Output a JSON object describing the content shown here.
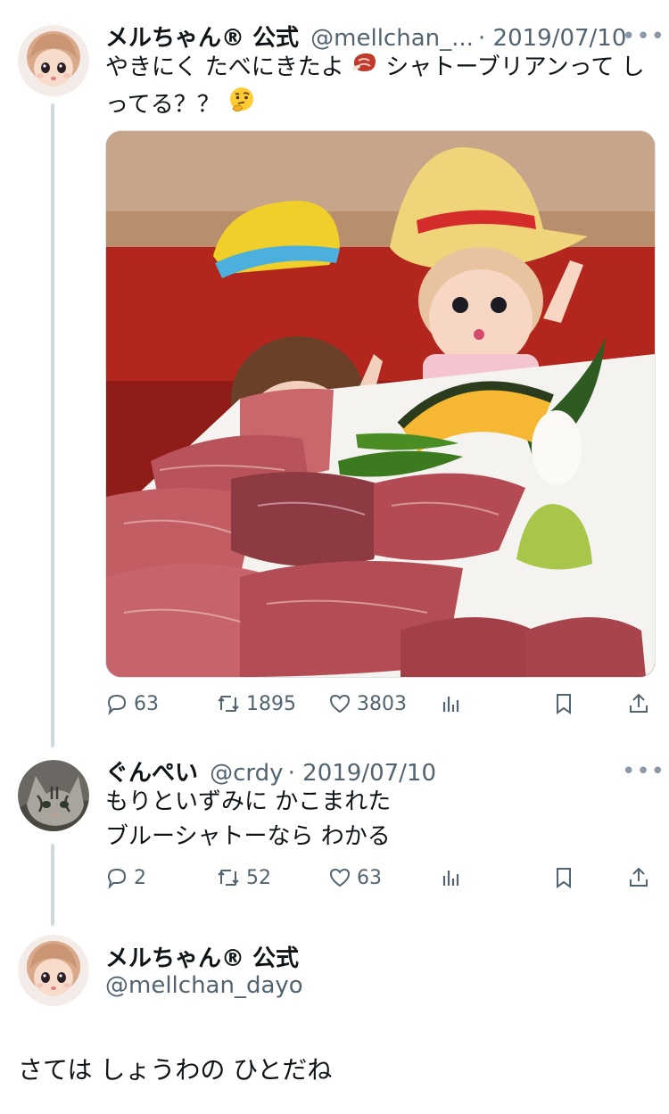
{
  "tweets": [
    {
      "display_name": "メルちゃん® 公式",
      "handle": "@mellchan_...",
      "date": "· 2019/07/10",
      "more": "•••",
      "text_line1_a": "やきにく たべにきたよ",
      "text_line1_b": "シャトーブリアンって し",
      "text_line2": "ってる？？",
      "emojis": [
        "meat-emoji",
        "thinking-face-emoji"
      ],
      "actions": {
        "replies": "63",
        "retweets": "1895",
        "likes": "3803"
      }
    },
    {
      "display_name": "ぐんぺい",
      "handle": "@crdy",
      "date": "· 2019/07/10",
      "more": "•••",
      "text_line1": "もりといずみに かこまれた",
      "text_line2": "ブルーシャトーなら わかる",
      "actions": {
        "replies": "2",
        "retweets": "52",
        "likes": "63"
      }
    },
    {
      "display_name": "メルちゃん® 公式",
      "handle": "@mellchan_dayo",
      "text": "さては しょうわの ひとだね"
    }
  ],
  "colors": {
    "icon_gray": "#536471",
    "thread_line": "#cfd9de"
  },
  "icons": [
    "reply-icon",
    "retweet-icon",
    "like-icon",
    "views-icon",
    "bookmark-icon",
    "share-icon"
  ]
}
